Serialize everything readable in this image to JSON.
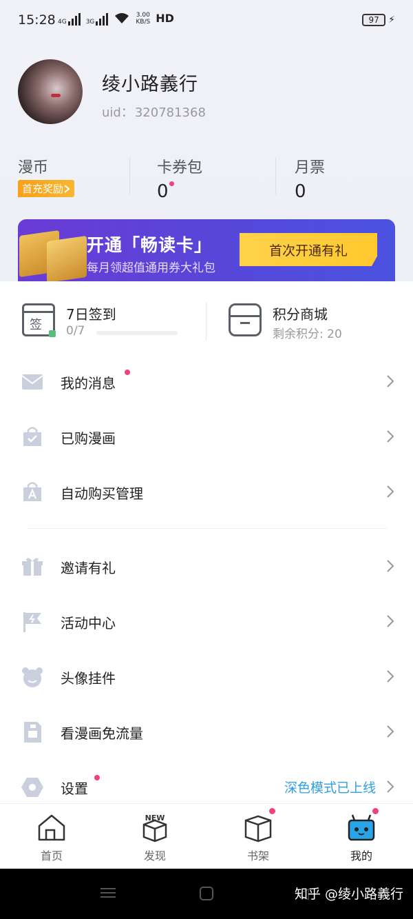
{
  "status_bar": {
    "time": "15:28",
    "net1": "4G",
    "net2": "3G",
    "speed": "3.00\nKB/S",
    "hd": "HD",
    "battery": "97"
  },
  "profile": {
    "username": "绫小路義行",
    "uid_label": "uid：",
    "uid_value": "320781368"
  },
  "stats": [
    {
      "label": "漫币",
      "badge": "首充奖励"
    },
    {
      "label": "卡券包",
      "value": "0"
    },
    {
      "label": "月票",
      "value": "0"
    }
  ],
  "vip_banner": {
    "title": "开通「畅读卡」",
    "subtitle": "每月领超值通用券大礼包",
    "button": "首次开通有礼"
  },
  "checkin": {
    "title": "7日签到",
    "progress": "0/7",
    "icon_char": "签"
  },
  "shop": {
    "title": "积分商城",
    "subtitle": "剩余积分: 20"
  },
  "menu": [
    {
      "label": "我的消息",
      "dot": true
    },
    {
      "label": "已购漫画"
    },
    {
      "label": "自动购买管理"
    },
    {
      "label": "邀请有礼"
    },
    {
      "label": "活动中心"
    },
    {
      "label": "头像挂件"
    },
    {
      "label": "看漫画免流量"
    },
    {
      "label": "设置",
      "dot": true,
      "right_text": "深色模式已上线"
    }
  ],
  "tabs": [
    {
      "label": "首页"
    },
    {
      "label": "发现",
      "icon_text": "NEW"
    },
    {
      "label": "书架"
    },
    {
      "label": "我的"
    }
  ],
  "watermark": "知乎 @绫小路義行",
  "colors": {
    "accent_pink": "#f0427a",
    "badge_orange": "#f7a11a",
    "vip_purple": "#5a45d8",
    "vip_button_yellow": "#ffd24a",
    "link_blue": "#2f9fe0"
  }
}
